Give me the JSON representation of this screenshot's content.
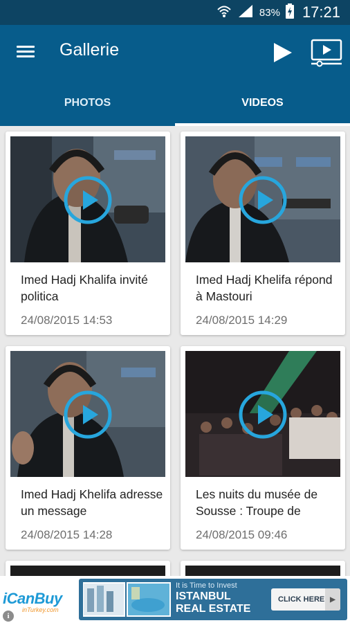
{
  "status_bar": {
    "battery_percent": "83%",
    "time": "17:21",
    "icons": [
      "wifi-icon",
      "signal-icon",
      "battery-charging-icon"
    ]
  },
  "app_bar": {
    "title": "Gallerie",
    "icons": [
      "menu-icon",
      "play-icon",
      "cast-icon"
    ]
  },
  "tabs": [
    {
      "label": "PHOTOS",
      "active": false
    },
    {
      "label": "VIDEOS",
      "active": true
    }
  ],
  "videos": [
    {
      "title": "Imed Hadj Khalifa invité politica",
      "date": "24/08/2015 14:53"
    },
    {
      "title": "Imed Hadj Khelifa répond à Mastouri",
      "date": "24/08/2015 14:29"
    },
    {
      "title": "Imed Hadj Khelifa adresse un message",
      "date": "24/08/2015 14:28"
    },
    {
      "title": "Les nuits du musée de Sousse : Troupe de",
      "date": "24/08/2015 09:46"
    }
  ],
  "ad": {
    "brand": "iCanBuy",
    "domain": "inTurkey.com",
    "tagline": "It is Time to Invest",
    "headline_line1": "ISTANBUL",
    "headline_line2": "REAL ESTATE",
    "cta": "CLICK HERE"
  },
  "colors": {
    "status_bar": "#0d4463",
    "app_bar": "#075c8b",
    "play_accent": "#27a6dd",
    "background": "#e9e9e9"
  }
}
